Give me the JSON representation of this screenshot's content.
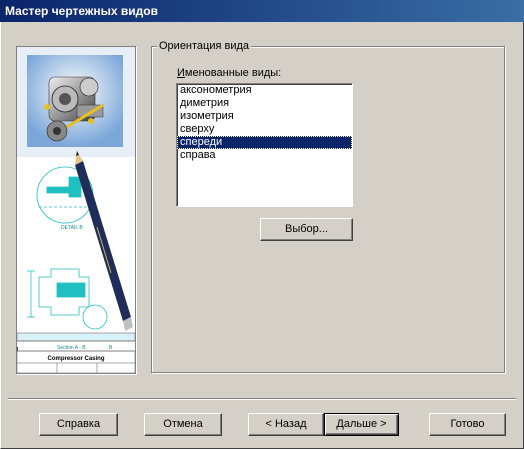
{
  "window": {
    "title": "Мастер чертежных видов"
  },
  "group": {
    "title": "Ориентация вида",
    "list_label_prefix": "И",
    "list_label_rest": "менованные виды:",
    "items": [
      "аксонометрия",
      "диметрия",
      "изометрия",
      "сверху",
      "спереди",
      "справа"
    ],
    "selected": "спереди",
    "select_button": "Выбор..."
  },
  "preview": {
    "detail_label": "DETAIL B",
    "section_label": "Section A - B",
    "section_letter": "B",
    "title_block_text": "Compressor Casing"
  },
  "buttons": {
    "help": "Справка",
    "cancel": "Отмена",
    "back": "< Назад",
    "next": "Дальше >",
    "finish": "Готово"
  },
  "colors": {
    "titlebar_start": "#0a246a",
    "titlebar_end": "#3a6ea5",
    "selection": "#0a246a",
    "drawing_accent": "#20c0c0"
  }
}
